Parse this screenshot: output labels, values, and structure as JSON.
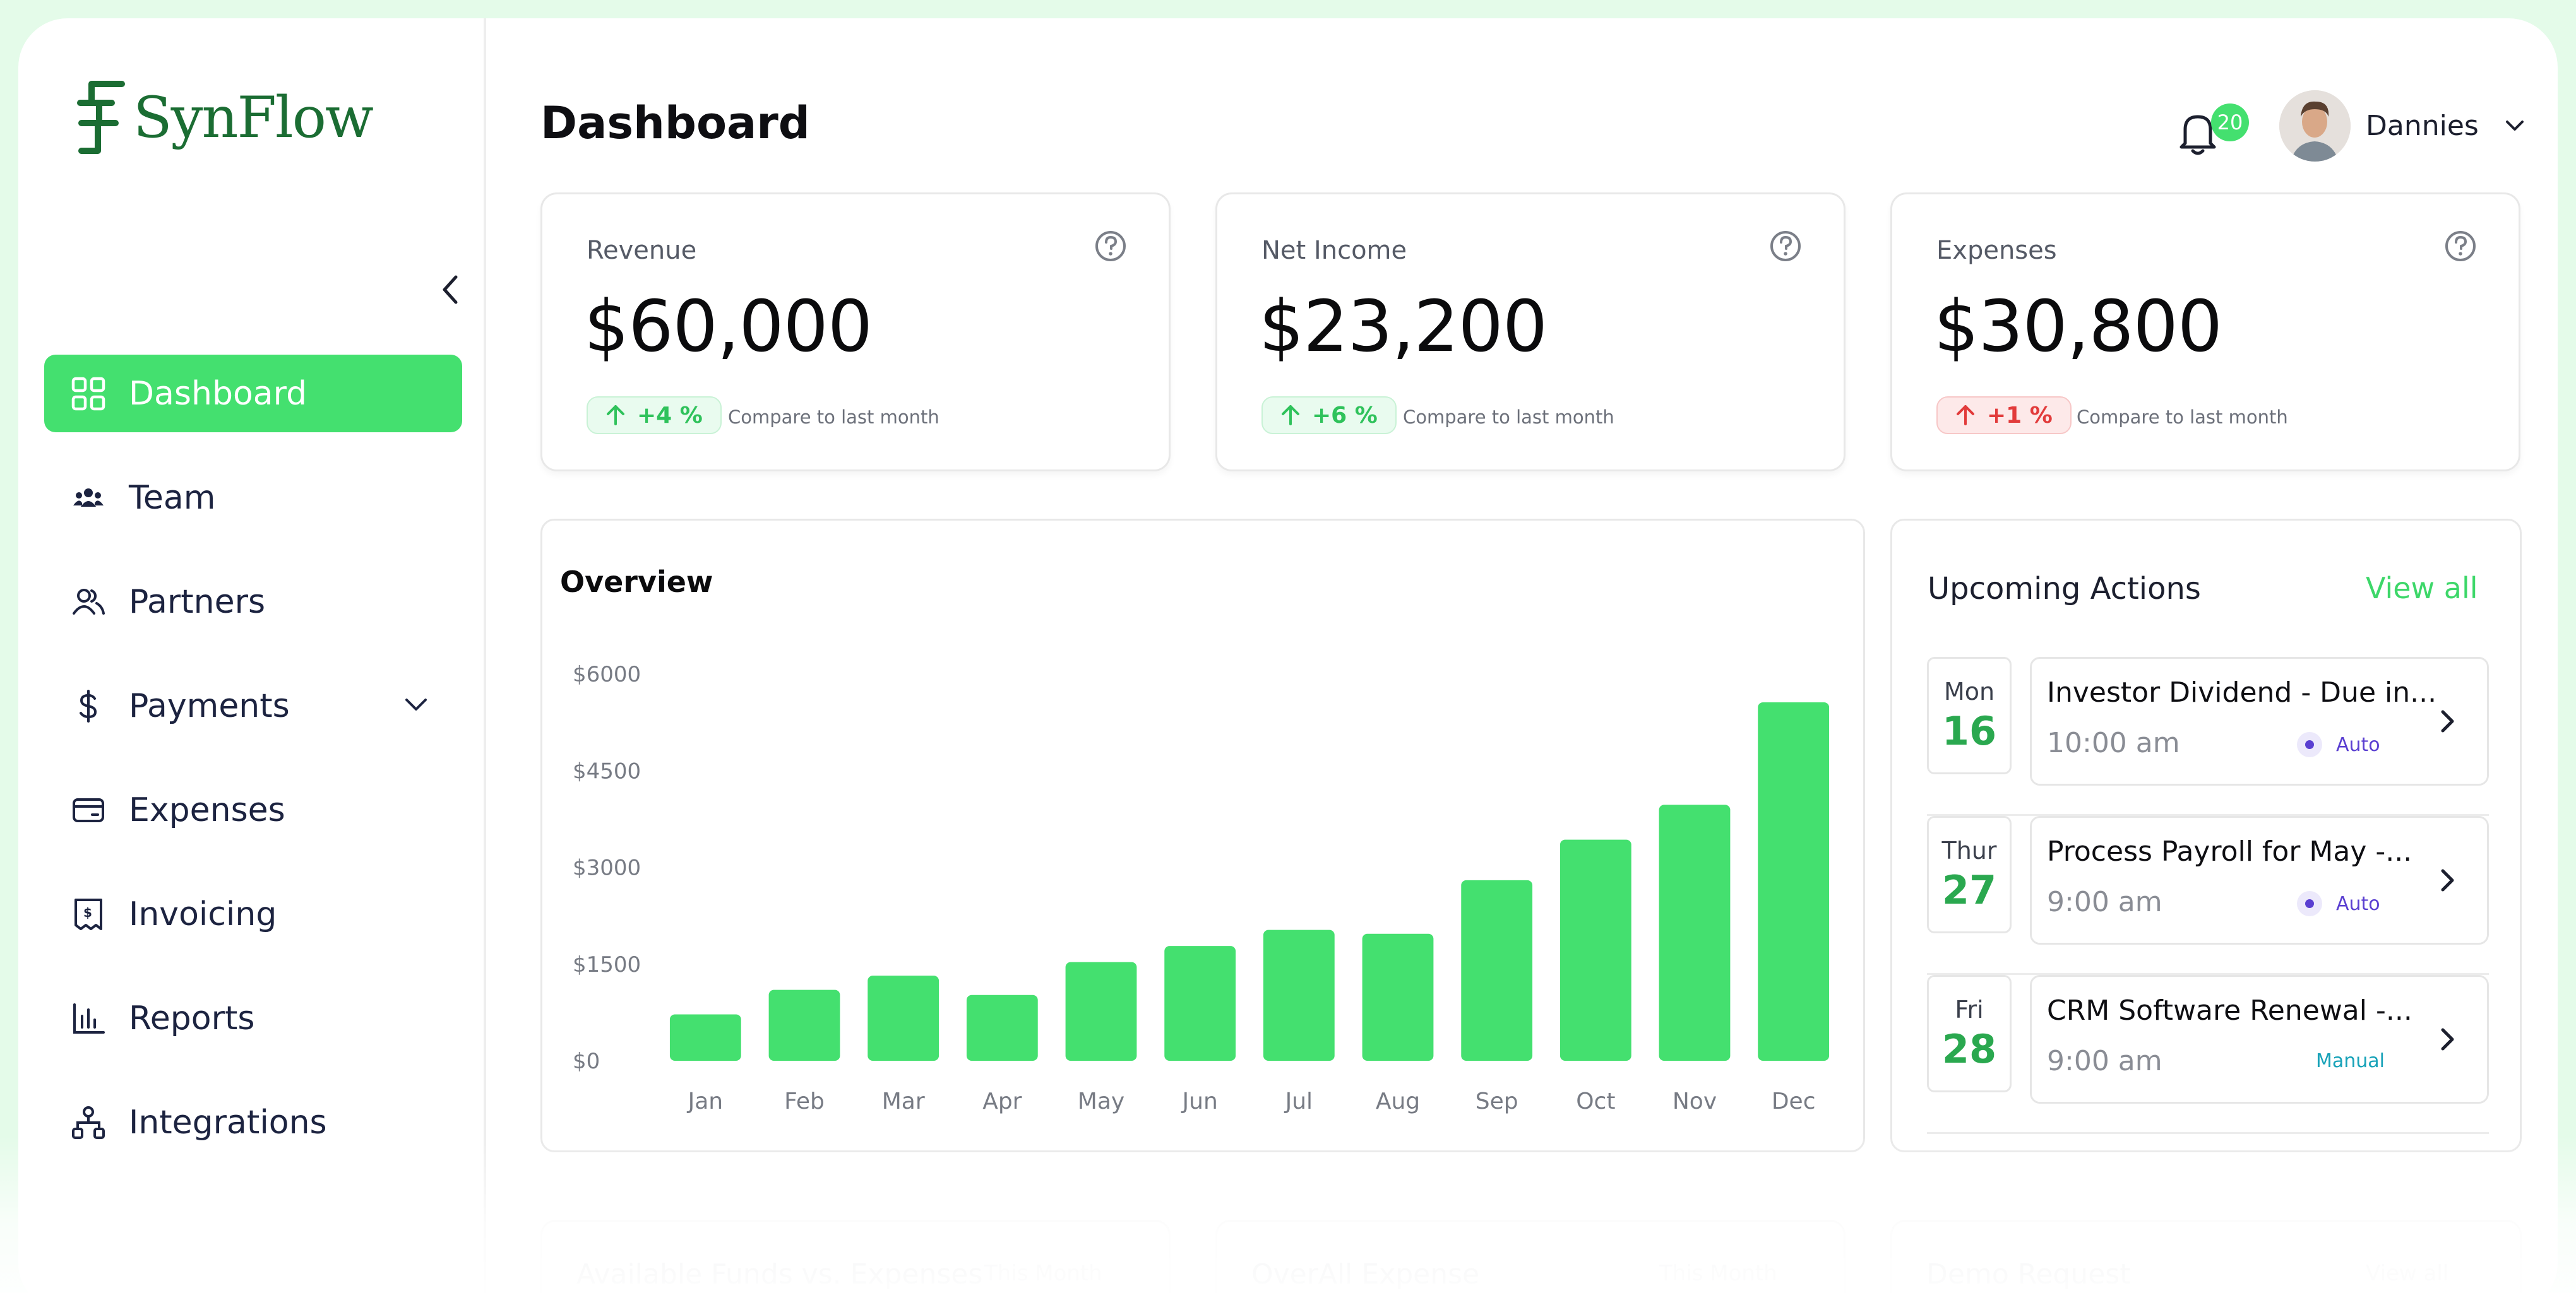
{
  "brand": {
    "name": "SynFlow"
  },
  "sidebar": {
    "items": [
      {
        "label": "Dashboard",
        "icon": "grid-icon",
        "active": true
      },
      {
        "label": "Team",
        "icon": "team-icon"
      },
      {
        "label": "Partners",
        "icon": "partners-icon"
      },
      {
        "label": "Payments",
        "icon": "dollar-icon",
        "has_submenu": true
      },
      {
        "label": "Expenses",
        "icon": "card-icon"
      },
      {
        "label": "Invoicing",
        "icon": "invoice-icon"
      },
      {
        "label": "Reports",
        "icon": "bar-chart-icon"
      },
      {
        "label": "Integrations",
        "icon": "integrations-icon"
      }
    ]
  },
  "header": {
    "title": "Dashboard",
    "notifications_count": "20",
    "user_name": "Dannies"
  },
  "kpis": [
    {
      "label": "Revenue",
      "value": "$60,000",
      "change": "+4 %",
      "trend": "up",
      "compare": "Compare to last month"
    },
    {
      "label": "Net Income",
      "value": "$23,200",
      "change": "+6 %",
      "trend": "up",
      "compare": "Compare to last month"
    },
    {
      "label": "Expenses",
      "value": "$30,800",
      "change": "+1 %",
      "trend": "down",
      "compare": "Compare to last month"
    }
  ],
  "overview": {
    "title": "Overview"
  },
  "chart_data": {
    "type": "bar",
    "categories": [
      "Jan",
      "Feb",
      "Mar",
      "Apr",
      "May",
      "Jun",
      "Jul",
      "Aug",
      "Sep",
      "Oct",
      "Nov",
      "Dec"
    ],
    "values": [
      720,
      1100,
      1320,
      1020,
      1530,
      1780,
      2030,
      1970,
      2800,
      3430,
      3970,
      5560
    ],
    "yticks": [
      "$0",
      "$1500",
      "$3000",
      "$4500",
      "$6000"
    ],
    "ylim": [
      0,
      6000
    ],
    "title": "Overview",
    "color": "#44e06f",
    "grid": false
  },
  "upcoming": {
    "title": "Upcoming Actions",
    "view_all": "View all",
    "actions": [
      {
        "dow": "Mon",
        "dom": "16",
        "title": "Investor Dividend - Due in...",
        "time": "10:00 am",
        "tag": "Auto"
      },
      {
        "dow": "Thur",
        "dom": "27",
        "title": "Process Payroll for May -...",
        "time": "9:00 am",
        "tag": "Auto"
      },
      {
        "dow": "Fri",
        "dom": "28",
        "title": "CRM Software Renewal -...",
        "time": "9:00 am",
        "tag": "Manual"
      }
    ]
  },
  "bottom_cards": [
    {
      "title": "Available Funds vs. Expenses",
      "right": "This Month"
    },
    {
      "title": "OverAll Expense",
      "right": "This Month"
    },
    {
      "title": "Demo Request",
      "right": "View all"
    }
  ],
  "colors": {
    "accent": "#44e06f",
    "brand": "#1b6d33",
    "negative": "#e23b3b",
    "tag_auto": "#5a3fd1",
    "tag_manual": "#17a2b8"
  }
}
